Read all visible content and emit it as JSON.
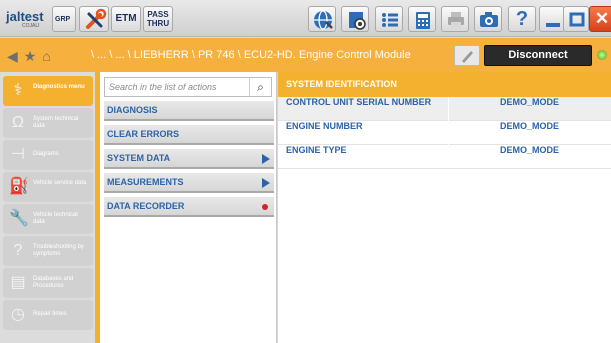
{
  "toolbar": {
    "logo_text": "jaltest",
    "logo_sub": "COJALI",
    "grp_label": "GRP",
    "etm_label": "ETM",
    "pass_label_1": "PASS",
    "pass_label_2": "THRU",
    "help_label": "?",
    "close_label": "✕"
  },
  "breadcrumb": {
    "path": "\\ ... \\ ... \\ LIEBHERR \\ PR 746 \\ ECU2-HD. Engine Control Module",
    "disconnect_label": "Disconnect"
  },
  "sidebar": {
    "items": [
      {
        "label": "Diagnostics menu",
        "icon": "stethoscope-icon"
      },
      {
        "label": "System technical data",
        "icon": "omega-icon"
      },
      {
        "label": "Diagrams",
        "icon": "diagram-icon"
      },
      {
        "label": "Vehicle service data",
        "icon": "oil-can-icon"
      },
      {
        "label": "Vehicle technical data",
        "icon": "wrench-icon"
      },
      {
        "label": "Troubleshooting by symptoms",
        "icon": "question-wrench-icon"
      },
      {
        "label": "Databases and Procedures",
        "icon": "document-gear-icon"
      },
      {
        "label": "Repair times",
        "icon": "clock-wrench-icon"
      }
    ]
  },
  "actions": {
    "search_placeholder": "Search in the list of actions",
    "items": [
      {
        "label": "DIAGNOSIS"
      },
      {
        "label": "CLEAR ERRORS"
      },
      {
        "label": "SYSTEM DATA"
      },
      {
        "label": "MEASUREMENTS"
      },
      {
        "label": "DATA RECORDER"
      }
    ]
  },
  "content": {
    "header": "SYSTEM IDENTIFICATION",
    "rows": [
      {
        "key": "CONTROL UNIT SERIAL NUMBER",
        "value": "DEMO_MODE"
      },
      {
        "key": "ENGINE NUMBER",
        "value": "DEMO_MODE"
      },
      {
        "key": "ENGINE TYPE",
        "value": "DEMO_MODE"
      }
    ]
  },
  "colors": {
    "accent": "#f4b12f",
    "link": "#2b63a8",
    "recorder_dot": "#d3242c",
    "close": "#e04a22"
  }
}
